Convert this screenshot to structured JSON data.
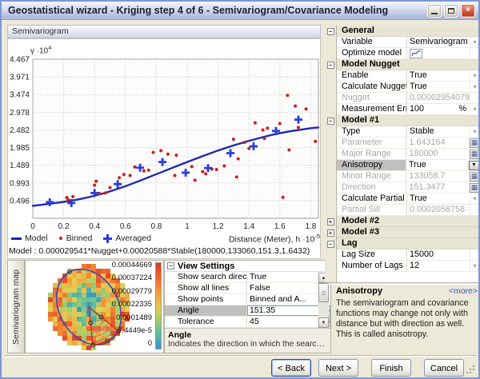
{
  "window": {
    "title": "Geostatistical wizard - Kriging step 4 of 6 - Semivariogram/Covariance Modeling"
  },
  "chart_panel": {
    "header": "Semivariogram",
    "ylabel_base": "γ ·10",
    "ylabel_exp": "4",
    "xlabel_base": "Distance (Meter), h ·10",
    "xlabel_exp": "-5",
    "legend": {
      "model": "Model",
      "binned": "Binned",
      "averaged": "Averaged"
    },
    "formula": "Model : 0.000029541*Nugget+0.00020588*Stable(180000,133060,151.3,1.6432)"
  },
  "chart_data": {
    "type": "line+scatter",
    "title": "Semivariogram",
    "ylabel": "gamma x10^4",
    "xlabel": "Distance (Meter), h x10^-5",
    "xlim": [
      0,
      1.85
    ],
    "ylim": [
      0,
      4.467
    ],
    "yticks": [
      0.496,
      0.993,
      1.489,
      1.985,
      2.482,
      2.978,
      3.474,
      3.971,
      4.467
    ],
    "xticks": [
      0,
      0.2,
      0.4,
      0.6,
      0.8,
      1,
      1.2,
      1.4,
      1.6,
      1.8
    ],
    "grid": true,
    "legend_position": "bottom",
    "series": [
      {
        "name": "Model",
        "type": "line",
        "color": "#1f27ae",
        "points": [
          [
            0,
            0.35
          ],
          [
            0.2,
            0.45
          ],
          [
            0.4,
            0.62
          ],
          [
            0.6,
            0.89
          ],
          [
            0.8,
            1.24
          ],
          [
            1.0,
            1.58
          ],
          [
            1.2,
            1.91
          ],
          [
            1.4,
            2.18
          ],
          [
            1.6,
            2.4
          ],
          [
            1.8,
            2.53
          ],
          [
            1.85,
            2.55
          ]
        ]
      },
      {
        "name": "Binned",
        "type": "scatter",
        "marker": "dot",
        "color": "#cf1d17",
        "points": [
          [
            0.22,
            0.58
          ],
          [
            0.23,
            0.52
          ],
          [
            0.26,
            0.61
          ],
          [
            0.4,
            0.93
          ],
          [
            0.41,
            1.04
          ],
          [
            0.43,
            0.7
          ],
          [
            0.47,
            0.71
          ],
          [
            0.5,
            0.86
          ],
          [
            0.56,
            1.14
          ],
          [
            0.59,
            1.23
          ],
          [
            0.63,
            1.2
          ],
          [
            0.66,
            1.44
          ],
          [
            0.72,
            1.33
          ],
          [
            0.75,
            1.35
          ],
          [
            0.78,
            1.85
          ],
          [
            0.83,
            1.9
          ],
          [
            0.875,
            1.8
          ],
          [
            0.92,
            1.2
          ],
          [
            0.93,
            1.77
          ],
          [
            1.03,
            1.45
          ],
          [
            1.05,
            1.07
          ],
          [
            1.1,
            1.31
          ],
          [
            1.12,
            1.25
          ],
          [
            1.16,
            1.38
          ],
          [
            1.19,
            1.37
          ],
          [
            1.24,
            1.47
          ],
          [
            1.3,
            2.22
          ],
          [
            1.32,
            1.16
          ],
          [
            1.33,
            1.67
          ],
          [
            1.37,
            2.13
          ],
          [
            1.4,
            1.96
          ],
          [
            1.44,
            2.68
          ],
          [
            1.49,
            2.48
          ],
          [
            1.5,
            2.24
          ],
          [
            1.52,
            2.53
          ],
          [
            1.6,
            2.66
          ],
          [
            1.62,
            0.59
          ],
          [
            1.65,
            3.45
          ],
          [
            1.66,
            1.92
          ],
          [
            1.7,
            3.15
          ],
          [
            1.72,
            2.55
          ],
          [
            1.77,
            3.07
          ],
          [
            1.83,
            2.16
          ]
        ]
      },
      {
        "name": "Averaged",
        "type": "scatter",
        "marker": "plus",
        "color": "#2a3fd4",
        "points": [
          [
            0.11,
            0.45
          ],
          [
            0.25,
            0.43
          ],
          [
            0.4,
            0.71
          ],
          [
            0.55,
            0.96
          ],
          [
            0.695,
            1.42
          ],
          [
            0.84,
            1.58
          ],
          [
            0.99,
            1.28
          ],
          [
            1.135,
            1.41
          ],
          [
            1.28,
            1.83
          ],
          [
            1.43,
            2.02
          ],
          [
            1.575,
            2.45
          ],
          [
            1.72,
            2.77
          ]
        ]
      }
    ]
  },
  "map_panel": {
    "tab_label": "Semivariogram map",
    "scale_labels": [
      "0.00044669",
      "0.00037224",
      "0.00029779",
      "0.00022335",
      "0.0001489",
      "7.4449e-5",
      "0"
    ],
    "sector_angle": 151.35,
    "sector_tolerance": 45,
    "ramp_colors": [
      "#d63a23",
      "#ed6b2d",
      "#f29d3a",
      "#e8cc52",
      "#a8cc66",
      "#5fbfa0",
      "#3a92c8"
    ]
  },
  "view_settings": {
    "title": "View Settings",
    "rows": [
      {
        "label": "Show search direction",
        "value": "True",
        "control": "dropdown",
        "selected": false
      },
      {
        "label": "Show all lines",
        "value": "False",
        "control": "dropdown",
        "selected": false
      },
      {
        "label": "Show points",
        "value": "Binned and A...",
        "control": "dropdown",
        "selected": false
      },
      {
        "label": "Angle",
        "value": "151.35",
        "control": "spinner",
        "selected": true
      },
      {
        "label": "Tolerance",
        "value": "45",
        "control": "spinner",
        "selected": false
      }
    ],
    "help_title": "Angle",
    "help_text": "Indicates the direction in which the search sector ..."
  },
  "properties": {
    "sections": [
      {
        "label": "General",
        "expanded": true,
        "rows": [
          {
            "label": "Variable",
            "value": "Semivariogram",
            "control": "dropdown"
          },
          {
            "label": "Optimize model",
            "value": "",
            "control": "optimize"
          }
        ]
      },
      {
        "label": "Model Nugget",
        "expanded": true,
        "rows": [
          {
            "label": "Enable",
            "value": "True",
            "control": "dropdown"
          },
          {
            "label": "Calculate Nugget",
            "value": "True",
            "control": "dropdown"
          },
          {
            "label": "Nugget",
            "value": "0.00002954079",
            "disabled": true
          },
          {
            "label": "Measurement Error",
            "value": "100",
            "suffix": "%",
            "control": "dropdown"
          }
        ]
      },
      {
        "label": "Model #1",
        "expanded": true,
        "rows": [
          {
            "label": "Type",
            "value": "Stable",
            "control": "dropdown"
          },
          {
            "label": "Parameter",
            "value": "1.643164",
            "disabled": true,
            "control": "calc"
          },
          {
            "label": "Major Range",
            "value": "180000",
            "disabled": true,
            "control": "calc"
          },
          {
            "label": "Anisotropy",
            "value": "True",
            "control": "dropdown",
            "selected": true
          },
          {
            "label": "Minor Range",
            "value": "133058.7",
            "disabled": true,
            "control": "calc"
          },
          {
            "label": "Direction",
            "value": "151.3477",
            "disabled": true,
            "control": "calc"
          },
          {
            "label": "Calculate Partial Sill",
            "value": "True",
            "control": "dropdown"
          },
          {
            "label": "Partial Sill",
            "value": "0.0002058758",
            "disabled": true
          }
        ]
      },
      {
        "label": "Model #2",
        "expanded": false,
        "rows": []
      },
      {
        "label": "Model #3",
        "expanded": false,
        "rows": []
      },
      {
        "label": "Lag",
        "expanded": true,
        "rows": [
          {
            "label": "Lag Size",
            "value": "15000"
          },
          {
            "label": "Number of Lags",
            "value": "12",
            "control": "dropdown"
          }
        ]
      }
    ],
    "help": {
      "title": "Anisotropy",
      "more": "<more>",
      "text": "The semivariogram and covariance functions may change not only with distance but with direction as well. This is called anisotropy."
    }
  },
  "wizard_buttons": {
    "back": "< Back",
    "next": "Next >",
    "finish": "Finish",
    "cancel": "Cancel"
  }
}
